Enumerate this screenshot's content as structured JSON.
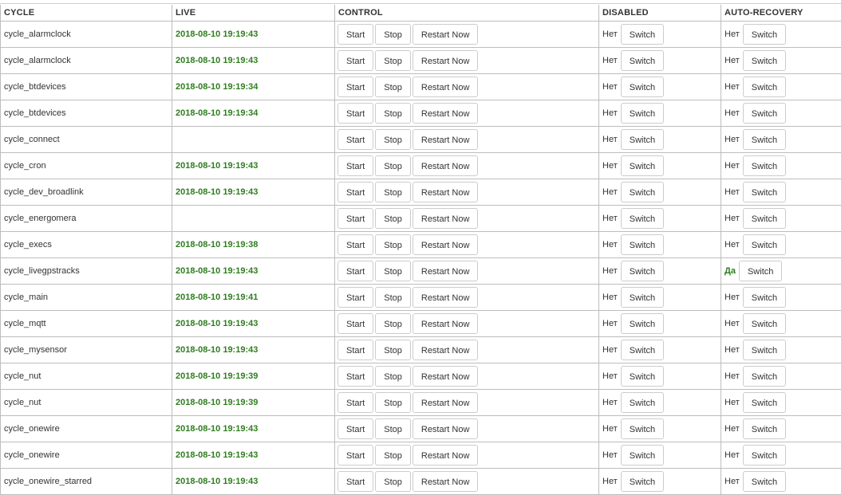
{
  "headers": {
    "cycle": "CYCLE",
    "live": "LIVE",
    "control": "CONTROL",
    "disabled": "DISABLED",
    "auto_recovery": "AUTO-RECOVERY"
  },
  "buttons": {
    "start": "Start",
    "stop": "Stop",
    "restart": "Restart Now",
    "switch": "Switch"
  },
  "colors": {
    "live_text": "#2e7d1e",
    "yes_text": "#2e7d1e",
    "grid": "#bdbdbd"
  },
  "rows": [
    {
      "cycle": "cycle_alarmclock",
      "live": "2018-08-10 19:19:43",
      "disabled": "Нет",
      "auto_recovery": "Нет"
    },
    {
      "cycle": "cycle_alarmclock",
      "live": "2018-08-10 19:19:43",
      "disabled": "Нет",
      "auto_recovery": "Нет"
    },
    {
      "cycle": "cycle_btdevices",
      "live": "2018-08-10 19:19:34",
      "disabled": "Нет",
      "auto_recovery": "Нет"
    },
    {
      "cycle": "cycle_btdevices",
      "live": "2018-08-10 19:19:34",
      "disabled": "Нет",
      "auto_recovery": "Нет"
    },
    {
      "cycle": "cycle_connect",
      "live": "",
      "disabled": "Нет",
      "auto_recovery": "Нет"
    },
    {
      "cycle": "cycle_cron",
      "live": "2018-08-10 19:19:43",
      "disabled": "Нет",
      "auto_recovery": "Нет"
    },
    {
      "cycle": "cycle_dev_broadlink",
      "live": "2018-08-10 19:19:43",
      "disabled": "Нет",
      "auto_recovery": "Нет"
    },
    {
      "cycle": "cycle_energomera",
      "live": "",
      "disabled": "Нет",
      "auto_recovery": "Нет"
    },
    {
      "cycle": "cycle_execs",
      "live": "2018-08-10 19:19:38",
      "disabled": "Нет",
      "auto_recovery": "Нет"
    },
    {
      "cycle": "cycle_livegpstracks",
      "live": "2018-08-10 19:19:43",
      "disabled": "Нет",
      "auto_recovery": "Да"
    },
    {
      "cycle": "cycle_main",
      "live": "2018-08-10 19:19:41",
      "disabled": "Нет",
      "auto_recovery": "Нет"
    },
    {
      "cycle": "cycle_mqtt",
      "live": "2018-08-10 19:19:43",
      "disabled": "Нет",
      "auto_recovery": "Нет"
    },
    {
      "cycle": "cycle_mysensor",
      "live": "2018-08-10 19:19:43",
      "disabled": "Нет",
      "auto_recovery": "Нет"
    },
    {
      "cycle": "cycle_nut",
      "live": "2018-08-10 19:19:39",
      "disabled": "Нет",
      "auto_recovery": "Нет"
    },
    {
      "cycle": "cycle_nut",
      "live": "2018-08-10 19:19:39",
      "disabled": "Нет",
      "auto_recovery": "Нет"
    },
    {
      "cycle": "cycle_onewire",
      "live": "2018-08-10 19:19:43",
      "disabled": "Нет",
      "auto_recovery": "Нет"
    },
    {
      "cycle": "cycle_onewire",
      "live": "2018-08-10 19:19:43",
      "disabled": "Нет",
      "auto_recovery": "Нет"
    },
    {
      "cycle": "cycle_onewire_starred",
      "live": "2018-08-10 19:19:43",
      "disabled": "Нет",
      "auto_recovery": "Нет"
    }
  ]
}
